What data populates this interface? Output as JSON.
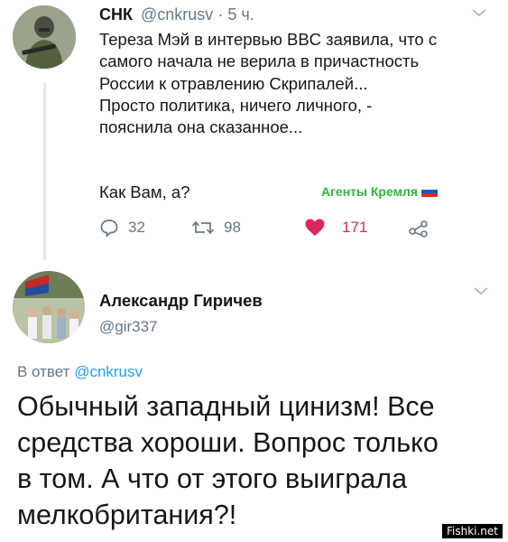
{
  "tweet": {
    "author_name": "СНК",
    "handle": "@cnkrusv",
    "separator": "·",
    "time": "5 ч.",
    "lines": [
      "Тереза Мэй в интервью BBC заявила, что с",
      "самого начала не верила в причастность",
      "России к отравлению Скрипалей...",
      "Просто политика, ничего личного, -",
      "пояснила она сказанное..."
    ],
    "closing": "Как Вам, а?",
    "tag_label": "Агенты Кремля",
    "actions": {
      "replies": "32",
      "retweets": "98",
      "likes": "171"
    },
    "icons": [
      "reply-icon",
      "retweet-icon",
      "heart-icon",
      "share-icon",
      "chevron-down-icon",
      "russian-flag-icon"
    ],
    "colors": {
      "tag_green": "#2db53c",
      "like_red": "#e0245e",
      "link_blue": "#1da1f2",
      "muted": "#657786"
    }
  },
  "reply": {
    "author_name": "Александр Гиричев",
    "handle": "@gir337",
    "in_reply_prefix": "В ответ",
    "in_reply_handle": "@cnkrusv",
    "lines": [
      "Обычный западный цинизм! Все",
      "средства хороши. Вопрос только",
      "в том. А что от этого выиграла",
      "мелкобритания?!"
    ]
  },
  "watermark": "Fishki.net"
}
